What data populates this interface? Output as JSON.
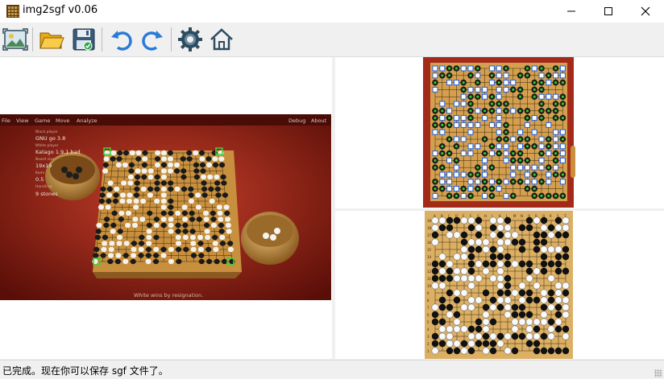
{
  "window": {
    "title": "img2sgf v0.06",
    "icons": [
      "app-board-icon",
      "minimize-icon",
      "maximize-icon",
      "close-icon"
    ]
  },
  "toolbar": {
    "buttons": [
      {
        "name": "open-image",
        "icon": "image-icon"
      },
      {
        "name": "open-file",
        "icon": "folder-icon"
      },
      {
        "name": "save",
        "icon": "save-icon"
      },
      {
        "name": "undo",
        "icon": "undo-icon"
      },
      {
        "name": "redo",
        "icon": "redo-icon"
      },
      {
        "name": "settings",
        "icon": "gear-icon"
      },
      {
        "name": "home",
        "icon": "home-icon"
      }
    ]
  },
  "source_image": {
    "menu": [
      "File",
      "View",
      "Game",
      "Move",
      "Analyze"
    ],
    "menu_right": [
      "Debug",
      "About"
    ],
    "info": [
      {
        "label": "Black player",
        "value": "GNU go 3.8"
      },
      {
        "label": "White player",
        "value": "Katago 1.9.1 bad"
      },
      {
        "label": "Board size",
        "value": "19x19"
      },
      {
        "label": "Komi",
        "value": "0.5"
      },
      {
        "label": "Handicap",
        "value": "9 stones"
      }
    ],
    "result": "White wins by resignation."
  },
  "status": {
    "text": "已完成。现在你可以保存 sgf 文件了。"
  },
  "colors": {
    "board": "#d9a95a",
    "detected_marker": "#3a8bff",
    "corner_marker": "#3cd23c",
    "scene_red": "#8a1e14"
  }
}
